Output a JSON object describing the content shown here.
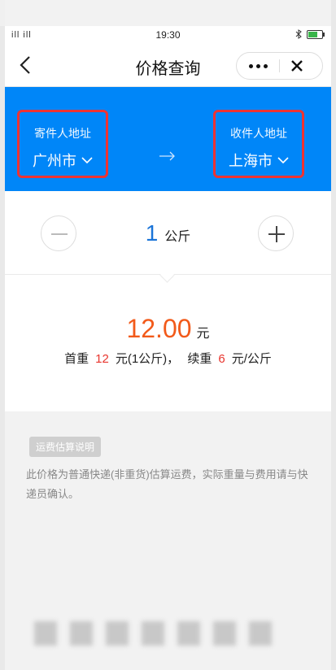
{
  "statusbar": {
    "signal": "ill ill",
    "time": "19:30"
  },
  "nav": {
    "title": "价格查询"
  },
  "route": {
    "sender_label": "寄件人地址",
    "sender_city": "广州市",
    "receiver_label": "收件人地址",
    "receiver_city": "上海市"
  },
  "weight": {
    "value": "1",
    "unit": "公斤"
  },
  "price": {
    "amount": "12.00",
    "currency": "元",
    "first_weight_label": "首重",
    "first_weight_price": "12",
    "first_weight_unit": "元(1公斤)，",
    "extra_weight_label": "续重",
    "extra_weight_price": "6",
    "extra_weight_unit": "元/公斤"
  },
  "note": {
    "tag": "运费估算说明",
    "text": "此价格为普通快递(非重货)估算运费，实际重量与费用请与快递员确认。"
  },
  "colors": {
    "brand_blue": "#0086f8",
    "price_orange": "#f25a1a",
    "highlight_red": "#e8352e"
  }
}
